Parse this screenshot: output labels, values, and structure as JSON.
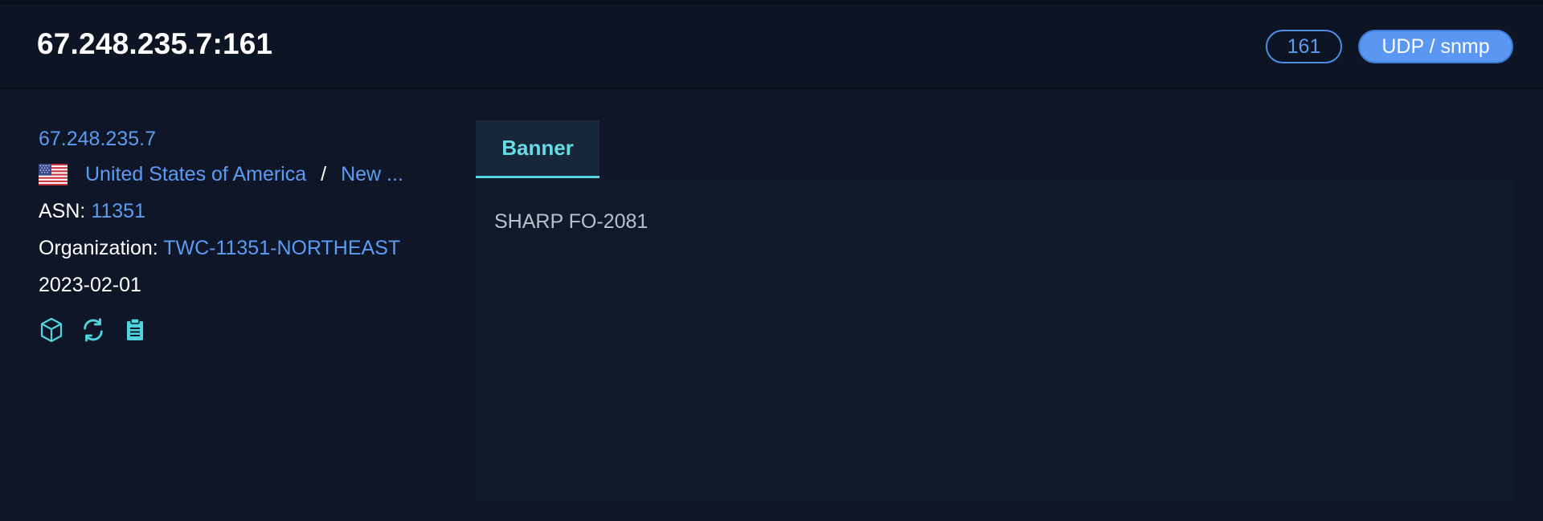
{
  "header": {
    "title": "67.248.235.7:161",
    "port_badge": "161",
    "protocol_badge": "UDP / snmp"
  },
  "host": {
    "ip": "67.248.235.7",
    "country": "United States of America",
    "separator": "/",
    "region": "New ...",
    "asn_label": "ASN:",
    "asn_value": "11351",
    "org_label": "Organization:",
    "org_value": "TWC-11351-NORTHEAST",
    "date": "2023-02-01",
    "flag": "us-flag-icon"
  },
  "actions": [
    {
      "icon": "cube-icon"
    },
    {
      "icon": "refresh-icon"
    },
    {
      "icon": "clipboard-icon"
    }
  ],
  "tabs": [
    {
      "label": "Banner",
      "active": true
    }
  ],
  "banner": {
    "content": "SHARP FO-2081"
  },
  "colors": {
    "link": "#5b9cf2",
    "accent": "#4fd4e0",
    "background": "#0f1627",
    "badge_fill": "#5a97f2"
  }
}
